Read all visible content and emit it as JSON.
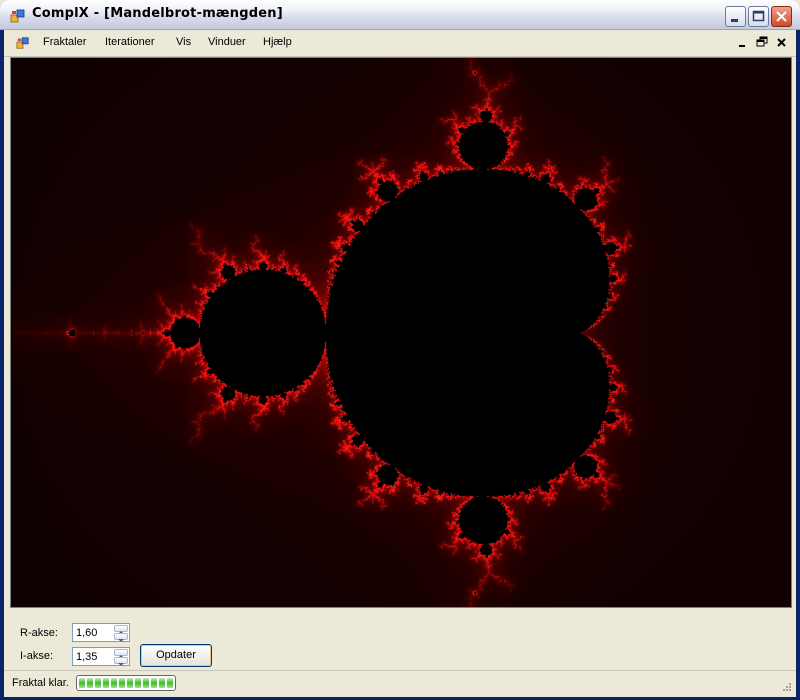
{
  "window": {
    "title": "ComplX - [Mandelbrot-mængden]",
    "icon": "app-window-icon",
    "controls": [
      "minimize-icon",
      "maximize-icon",
      "close-icon"
    ]
  },
  "menubar": {
    "items": [
      {
        "label": "Fraktaler"
      },
      {
        "label": "Iterationer"
      },
      {
        "label": "Vis"
      },
      {
        "label": "Vinduer"
      },
      {
        "label": "Hjælp"
      }
    ],
    "mdi_controls": [
      "mdi-minimize-icon",
      "mdi-restore-icon",
      "mdi-close-icon"
    ]
  },
  "canvas": {
    "content": "mandelbrot-set",
    "colors": {
      "set": "#000000",
      "edge": "#ff2020",
      "background": "#0a0000"
    }
  },
  "controls": {
    "r_axis": {
      "label": "R-akse:",
      "value": "1,60"
    },
    "i_axis": {
      "label": "I-akse:",
      "value": "1,35"
    },
    "update_button": "Opdater"
  },
  "statusbar": {
    "text": "Fraktal klar.",
    "progress_fraction": 1.0
  },
  "colors": {
    "xp_face": "#ece9d8",
    "xp_border": "#7f9db9",
    "close_red": "#d1492b"
  }
}
